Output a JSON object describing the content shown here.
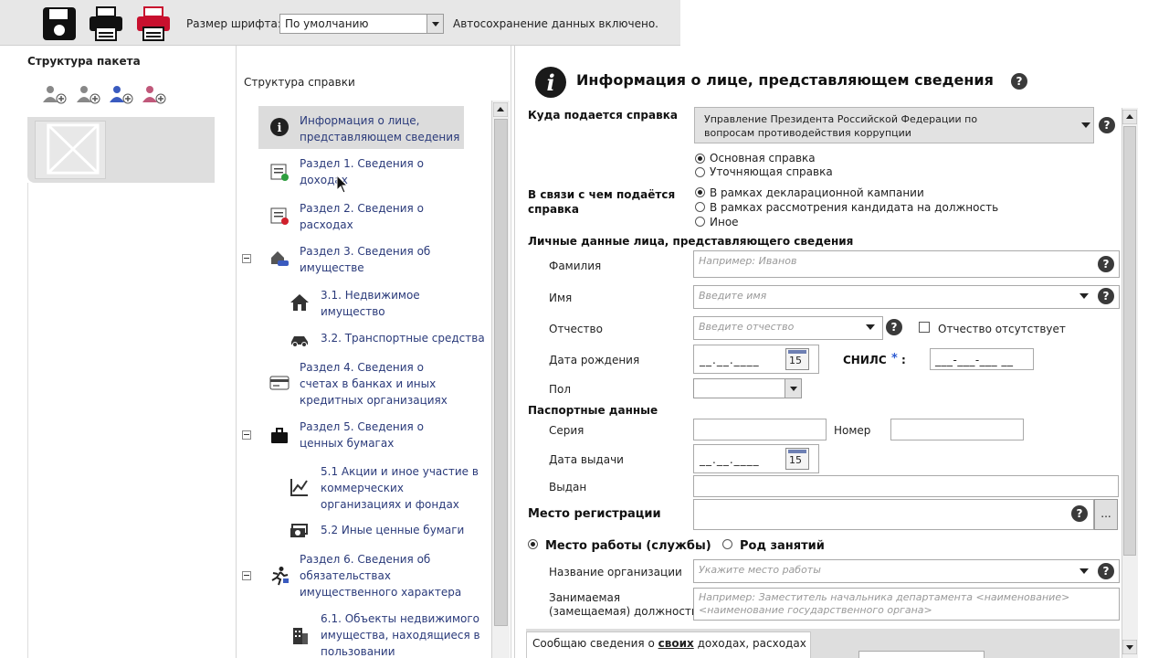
{
  "toolbar": {
    "font_size_label": "Размер шрифта:",
    "font_size_value": "По умолчанию",
    "autosave_text": "Автосохранение данных включено."
  },
  "package": {
    "title": "Структура пакета"
  },
  "tree": {
    "title": "Структура справки",
    "items": [
      {
        "label": "Информация о лице, представляющем сведения",
        "icon": "info-icon"
      },
      {
        "label": "Раздел 1. Сведения о доходах",
        "icon": "income-doc-icon"
      },
      {
        "label": "Раздел 2. Сведения о расходах",
        "icon": "expense-doc-icon"
      },
      {
        "label": "Раздел 3. Сведения об имуществе",
        "icon": "property-icon"
      },
      {
        "label": "3.1. Недвижимое имущество",
        "icon": "house-icon"
      },
      {
        "label": "3.2. Транспортные средства",
        "icon": "car-icon"
      },
      {
        "label": "Раздел 4. Сведения о счетах в банках и иных кредитных организациях",
        "icon": "bank-card-icon"
      },
      {
        "label": "Раздел 5. Сведения о ценных бумагах",
        "icon": "briefcase-icon"
      },
      {
        "label": "5.1 Акции и иное участие в коммерческих организациях и фондах",
        "icon": "chart-icon"
      },
      {
        "label": "5.2 Иные ценные бумаги",
        "icon": "money-icon"
      },
      {
        "label": "Раздел 6. Сведения об обязательствах имущественного характера",
        "icon": "runner-icon"
      },
      {
        "label": "6.1. Объекты недвижимого имущества, находящиеся в пользовании",
        "icon": "building-icon"
      }
    ]
  },
  "form": {
    "title": "Информация о лице, представляющем сведения",
    "where_label": "Куда подается справка",
    "where_value": "Управление Президента Российской Федерации по вопросам противодействия коррупции",
    "report_type": [
      "Основная справка",
      "Уточняющая справка"
    ],
    "reason_label": "В связи с чем подаётся справка",
    "reason_options": [
      "В рамках декларационной кампании",
      "В рамках рассмотрения кандидата на должность",
      "Иное"
    ],
    "personal_section": "Личные данные лица, представляющего сведения",
    "surname_label": "Фамилия",
    "surname_placeholder": "Например:  Иванов",
    "name_label": "Имя",
    "name_placeholder": "Введите имя",
    "patronymic_label": "Отчество",
    "patronymic_placeholder": "Введите отчество",
    "no_patronymic_label": "Отчество отсутствует",
    "birth_label": "Дата рождения",
    "date_mask": "__.__.____",
    "calendar_day": "15",
    "snils_label": "СНИЛС",
    "snils_required": "*",
    "snils_colon": ":",
    "snils_mask": "___-___-___ __",
    "gender_label": "Пол",
    "passport_section": "Паспортные данные",
    "series_label": "Серия",
    "number_label": "Номер",
    "issue_date_label": "Дата выдачи",
    "issued_by_label": "Выдан",
    "registration_label": "Место регистрации",
    "browse_label": "...",
    "work_place_label": "Место работы (службы)",
    "occupation_label": "Род занятий",
    "org_name_label": "Название организации",
    "org_name_placeholder": "Укажите место работы",
    "position_label_1": "Занимаемая",
    "position_label_2": "(замещаемая) должность",
    "position_placeholder": "Например:  Заместитель начальника департамента <наименование> <наименование государственного органа>",
    "bottom_text_prefix": "Сообщаю сведения о",
    "bottom_text_bold": "своих",
    "bottom_text_suffix": "доходах, расходах",
    "help_glyph": "?"
  }
}
